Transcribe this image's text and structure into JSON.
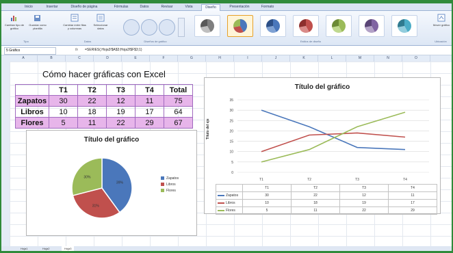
{
  "ribbon": {
    "tabs": [
      "Inicio",
      "Insertar",
      "Diseño de página",
      "Fórmulas",
      "Datos",
      "Revisar",
      "Vista",
      "Diseño",
      "Presentación",
      "Formato"
    ],
    "active_tab": "Diseño",
    "buttons": {
      "change_type": "Cambiar tipo de gráfico",
      "save_template": "Guardar como plantilla",
      "switch_rows": "Cambiar entre filas y columnas",
      "select_data": "Seleccionar datos",
      "move_chart": "Mover gráfico"
    },
    "groups": {
      "type": "Tipo",
      "data": "Datos",
      "layouts": "Diseños de gráfico",
      "styles": "Estilos de diseño",
      "location": "Ubicación"
    }
  },
  "formula_bar": {
    "name_box": "5 Gráfico",
    "fx": "fx",
    "formula": "=SERIES(;Hoja3!$A$3;Hoja3!$F$3;1)"
  },
  "columns": [
    "A",
    "B",
    "C",
    "D",
    "E",
    "F",
    "G",
    "H",
    "I",
    "J",
    "K",
    "L",
    "M",
    "N",
    "O"
  ],
  "sheet": {
    "title": "Cómo hacer gráficas con Excel",
    "headers": [
      "",
      "T1",
      "T2",
      "T3",
      "T4",
      "Total"
    ],
    "rows": [
      {
        "label": "Zapatos",
        "values": [
          "30",
          "22",
          "12",
          "11",
          "75"
        ]
      },
      {
        "label": "Libros",
        "values": [
          "10",
          "18",
          "19",
          "17",
          "64"
        ]
      },
      {
        "label": "Flores",
        "values": [
          "5",
          "11",
          "22",
          "29",
          "67"
        ]
      }
    ],
    "tabs": [
      "Hoja1",
      "Hoja2",
      "Hoja3"
    ],
    "active_tab": "Hoja3"
  },
  "colors": {
    "zapatos": "#4a77bb",
    "libros": "#c0504d",
    "flores": "#9bbb59",
    "highlight": "#e7b5ea"
  },
  "chart_data": [
    {
      "type": "pie",
      "title": "Título del gráfico",
      "categories": [
        "Zapatos",
        "Libros",
        "Flores"
      ],
      "values": [
        40,
        31,
        29
      ],
      "labels": [
        "39%",
        "31%",
        "30%"
      ],
      "legend": "right"
    },
    {
      "type": "line",
      "title": "Título del gráfico",
      "ylabel": "Título del eje",
      "categories": [
        "T1",
        "T2",
        "T3",
        "T4"
      ],
      "ylim": [
        0,
        35
      ],
      "yticks": [
        "0",
        "5",
        "10",
        "15",
        "20",
        "25",
        "30",
        "35"
      ],
      "series": [
        {
          "name": "Zapatos",
          "values": [
            30,
            22,
            12,
            11
          ]
        },
        {
          "name": "Libros",
          "values": [
            10,
            18,
            19,
            17
          ]
        },
        {
          "name": "Flores",
          "values": [
            5,
            11,
            22,
            29
          ]
        }
      ],
      "legend": "data table"
    }
  ]
}
